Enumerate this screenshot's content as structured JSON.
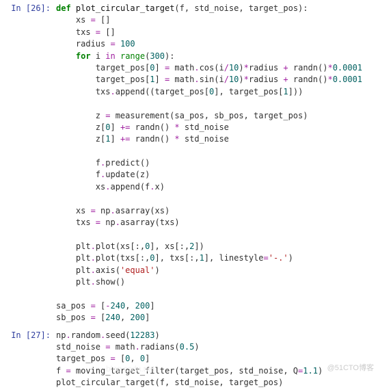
{
  "cells": [
    {
      "prompt": "In [26]:",
      "code_html": "<span class='kw'>def</span> <span class='nm'>plot_circular_target</span>(f, std_noise, target_pos):\n    xs <span class='op'>=</span> []\n    txs <span class='op'>=</span> []\n    radius <span class='op'>=</span> <span class='nb'>100</span>\n    <span class='kw'>for</span> i <span class='op'>in</span> <span class='bi'>range</span>(<span class='nb'>300</span>):\n        target_pos[<span class='nb'>0</span>] <span class='op'>=</span> math<span class='op'>.</span>cos(i<span class='op'>/</span><span class='nb'>10</span>)<span class='op'>*</span>radius <span class='op'>+</span> randn()<span class='op'>*</span><span class='nb'>0.0001</span>\n        target_pos[<span class='nb'>1</span>] <span class='op'>=</span> math<span class='op'>.</span>sin(i<span class='op'>/</span><span class='nb'>10</span>)<span class='op'>*</span>radius <span class='op'>+</span> randn()<span class='op'>*</span><span class='nb'>0.0001</span>\n        txs<span class='op'>.</span>append((target_pos[<span class='nb'>0</span>], target_pos[<span class='nb'>1</span>]))\n\n        z <span class='op'>=</span> measurement(sa_pos, sb_pos, target_pos)\n        z[<span class='nb'>0</span>] <span class='op'>+=</span> randn() <span class='op'>*</span> std_noise\n        z[<span class='nb'>1</span>] <span class='op'>+=</span> randn() <span class='op'>*</span> std_noise\n\n        f<span class='op'>.</span>predict()\n        f<span class='op'>.</span>update(z)\n        xs<span class='op'>.</span>append(f<span class='op'>.</span>x)\n\n    xs <span class='op'>=</span> np<span class='op'>.</span>asarray(xs)\n    txs <span class='op'>=</span> np<span class='op'>.</span>asarray(txs)\n\n    plt<span class='op'>.</span>plot(xs[:,<span class='nb'>0</span>], xs[:,<span class='nb'>2</span>])\n    plt<span class='op'>.</span>plot(txs[:,<span class='nb'>0</span>], txs[:,<span class='nb'>1</span>], linestyle<span class='op'>=</span><span class='st'>'-.'</span>)\n    plt<span class='op'>.</span>axis(<span class='st'>'equal'</span>)\n    plt<span class='op'>.</span>show()\n\nsa_pos <span class='op'>=</span> [<span class='op'>-</span><span class='nb'>240</span>, <span class='nb'>200</span>]\nsb_pos <span class='op'>=</span> [<span class='nb'>240</span>, <span class='nb'>200</span>]"
    },
    {
      "prompt": "In [27]:",
      "code_html": "np<span class='op'>.</span>random<span class='op'>.</span>seed(<span class='nb'>12283</span>)\nstd_noise <span class='op'>=</span> math<span class='op'>.</span>radians(<span class='nb'>0.5</span>)\ntarget_pos <span class='op'>=</span> [<span class='nb'>0</span>, <span class='nb'>0</span>]\nf <span class='op'>=</span> moving_target_filter(target_pos, std_noise, Q<span class='op'>=</span><span class='nb'>1.1</span>)\nplot_circular_target(f, std_noise, target_pos)"
    }
  ],
  "watermark_right": "@51CTO博客",
  "watermark_bg": "blog.csdn.net"
}
